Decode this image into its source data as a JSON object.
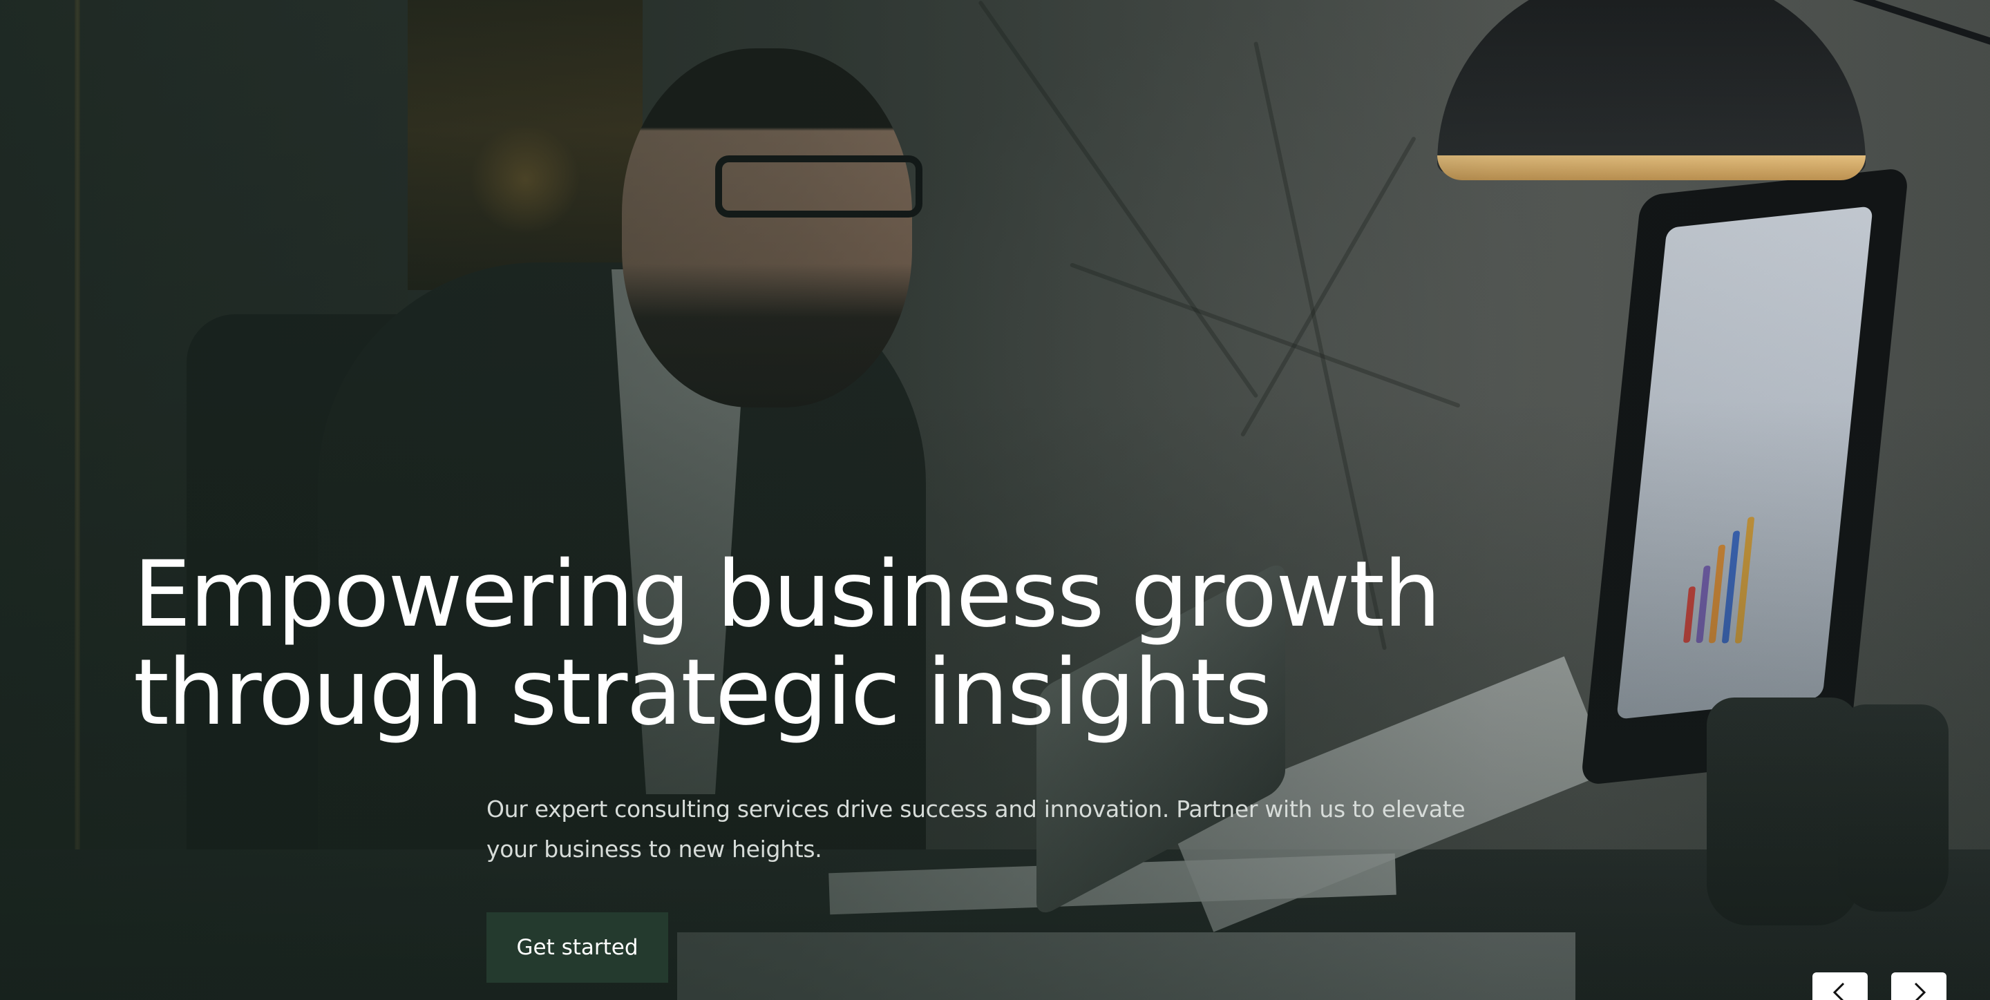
{
  "hero": {
    "headline_line1": "Empowering business growth",
    "headline_line2": "through strategic insights",
    "subtext_line1": "Our expert consulting services drive success and innovation. Partner with us to elevate",
    "subtext_line2": "your business to new heights.",
    "cta_label": "Get started",
    "background_image": "businessman-with-tablet-at-desk",
    "accent_color": "#243a2e"
  },
  "carousel": {
    "prev_icon": "chevron-left-icon",
    "next_icon": "chevron-right-icon"
  }
}
